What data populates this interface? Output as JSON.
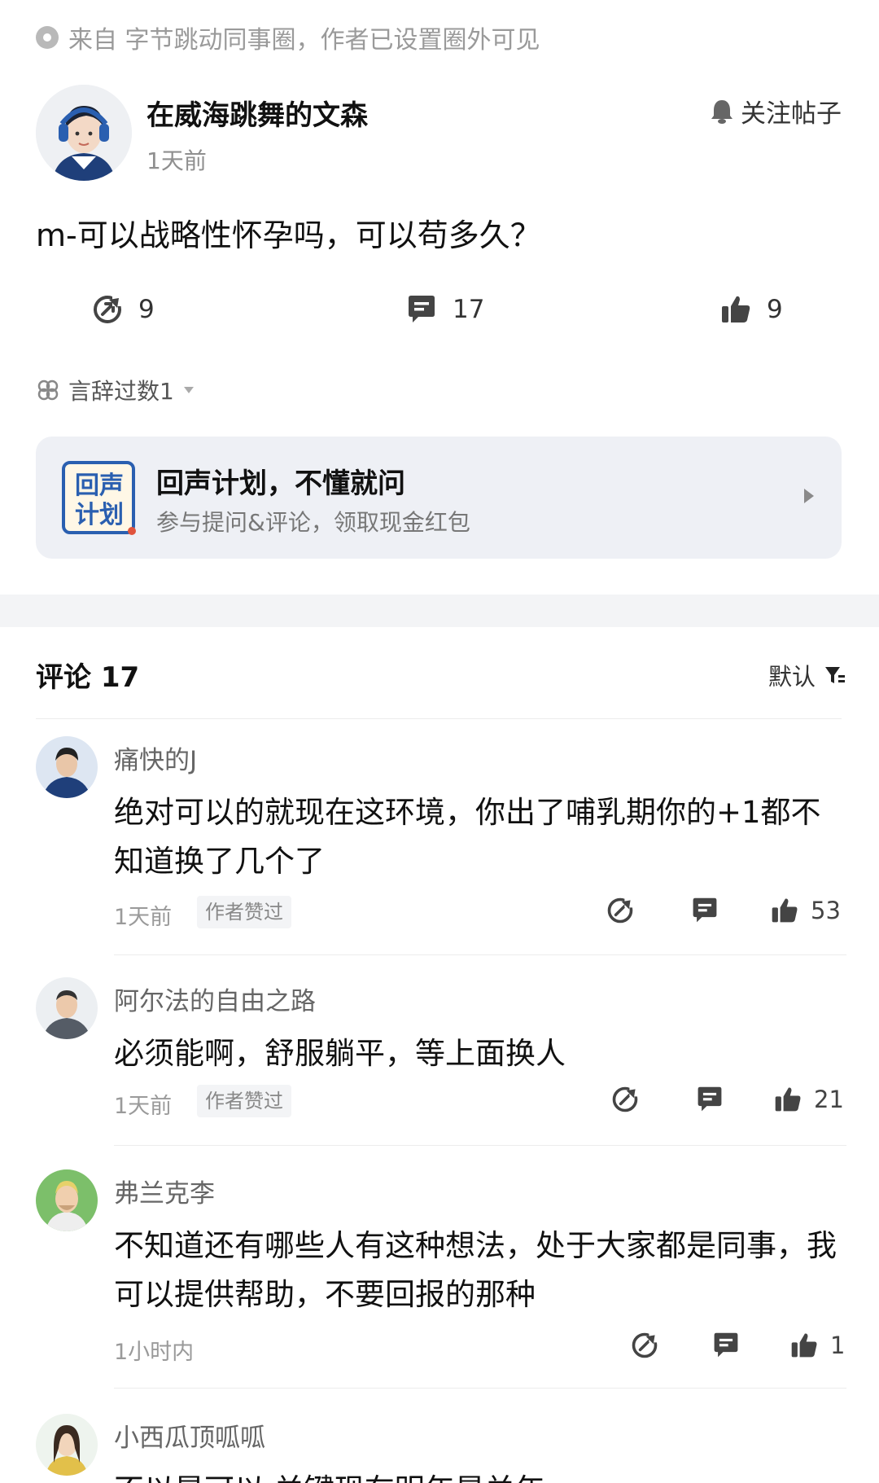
{
  "source": {
    "text": "来自 字节跳动同事圈，作者已设置圈外可见"
  },
  "post": {
    "author_name": "在威海跳舞的文森",
    "time": "1天前",
    "follow_label": "关注帖子",
    "title": "m-可以战略性怀孕吗，可以苟多久？",
    "share_count": "9",
    "comment_count": "17",
    "like_count": "9",
    "emoji_reaction": "言辞过数1"
  },
  "banner": {
    "logo_text_top": "回声",
    "logo_text_bottom": "计划",
    "title": "回声计划，不懂就问",
    "subtitle": "参与提问&评论，领取现金红包"
  },
  "comments_section": {
    "title": "评论 17",
    "sort_label": "默认"
  },
  "comments": [
    {
      "name": "痛快的J",
      "text": "绝对可以的就现在这环境，你出了哺乳期你的+1都不知道换了几个了",
      "time": "1天前",
      "badge": "作者赞过",
      "likes": "53"
    },
    {
      "name": "阿尔法的自由之路",
      "text": "必须能啊，舒服躺平，等上面换人",
      "time": "1天前",
      "badge": "作者赞过",
      "likes": "21"
    },
    {
      "name": "弗兰克李",
      "text": "不知道还有哪些人有这种想法，处于大家都是同事，我可以提供帮助，不要回报的那种",
      "time": "1小时内",
      "badge": "",
      "likes": "1"
    },
    {
      "name": "小西瓜顶呱呱",
      "text": "不以是可以 关键现在明年是关年",
      "time": "",
      "badge": "",
      "likes": ""
    }
  ],
  "colors": {
    "accent_blue": "#2a5fb0",
    "accent_red": "#e0533c",
    "text_gray": "#9a9a9a"
  }
}
